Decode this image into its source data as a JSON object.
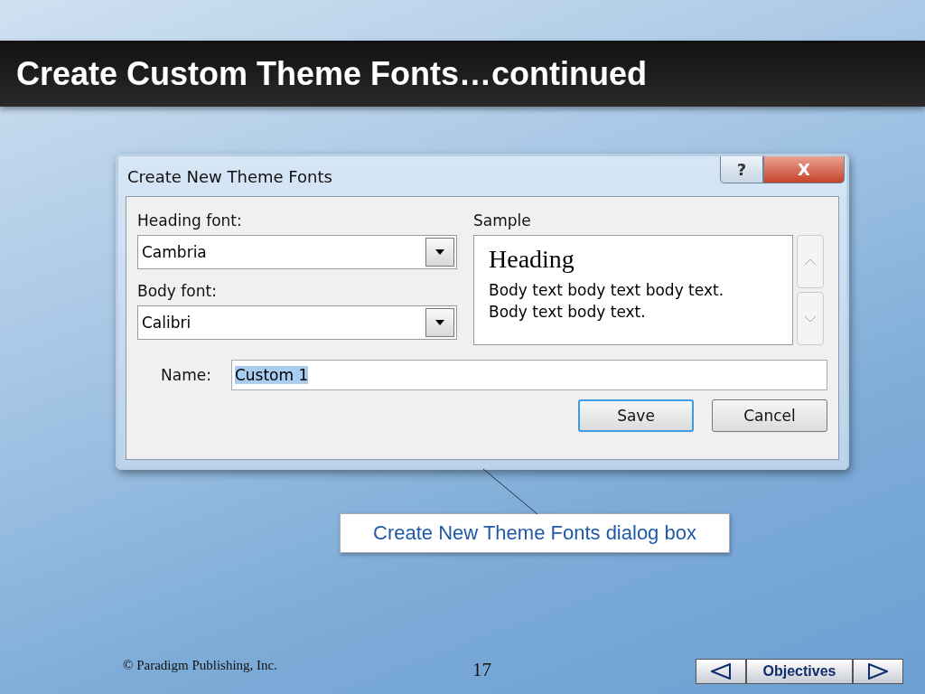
{
  "slide_title": "Create Custom Theme Fonts…continued",
  "dialog": {
    "title": "Create New Theme Fonts",
    "help_button": "?",
    "close_button": "X",
    "heading_font": {
      "label": "Heading font:",
      "value": "Cambria"
    },
    "body_font": {
      "label": "Body font:",
      "value": "Calibri"
    },
    "sample": {
      "label": "Sample",
      "heading": "Heading",
      "lines": [
        "Body text body text body text.",
        "Body text body text."
      ]
    },
    "name": {
      "label": "Name:",
      "value": "Custom 1",
      "selected": true
    },
    "buttons": [
      {
        "label": "Save",
        "default": true
      },
      {
        "label": "Cancel",
        "default": false
      }
    ]
  },
  "callout": "Create New Theme Fonts dialog box",
  "footer": {
    "copyright": "© Paradigm Publishing, Inc.",
    "page": "17",
    "nav_label": "Objectives"
  }
}
